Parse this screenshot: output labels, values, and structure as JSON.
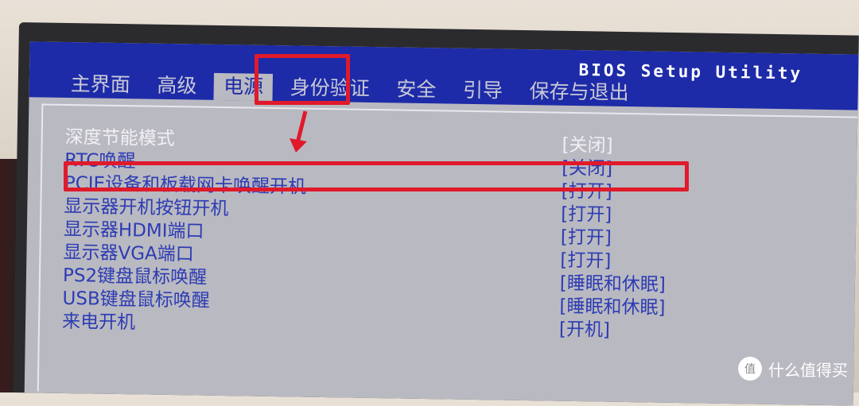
{
  "header": {
    "title": "BIOS Setup Utility",
    "tabs": [
      {
        "label": "主界面"
      },
      {
        "label": "高级"
      },
      {
        "label": "电源"
      },
      {
        "label": "身份验证"
      },
      {
        "label": "安全"
      },
      {
        "label": "引导"
      },
      {
        "label": "保存与退出"
      }
    ],
    "active_tab": "电源"
  },
  "settings": [
    {
      "label": "深度节能模式",
      "value": "[关闭]"
    },
    {
      "label": "RTC唤醒",
      "value": "[关闭]"
    },
    {
      "label": "PCIE设备和板载网卡唤醒开机",
      "value": "[打开]"
    },
    {
      "label": "显示器开机按钮开机",
      "value": "[打开]"
    },
    {
      "label": "显示器HDMI端口",
      "value": "[打开]"
    },
    {
      "label": "显示器VGA端口",
      "value": "[打开]"
    },
    {
      "label": "PS2键盘鼠标唤醒",
      "value": "[睡眠和休眠]"
    },
    {
      "label": "USB键盘鼠标唤醒",
      "value": "[睡眠和休眠]"
    },
    {
      "label": "来电开机",
      "value": "[开机]"
    }
  ],
  "watermark": {
    "text": "什么值得买",
    "icon": "zhi-logo-icon"
  },
  "colors": {
    "bios_blue": "#1d2ba8",
    "highlight_red": "#e01a2b",
    "panel_gray": "#b9b9c1"
  }
}
